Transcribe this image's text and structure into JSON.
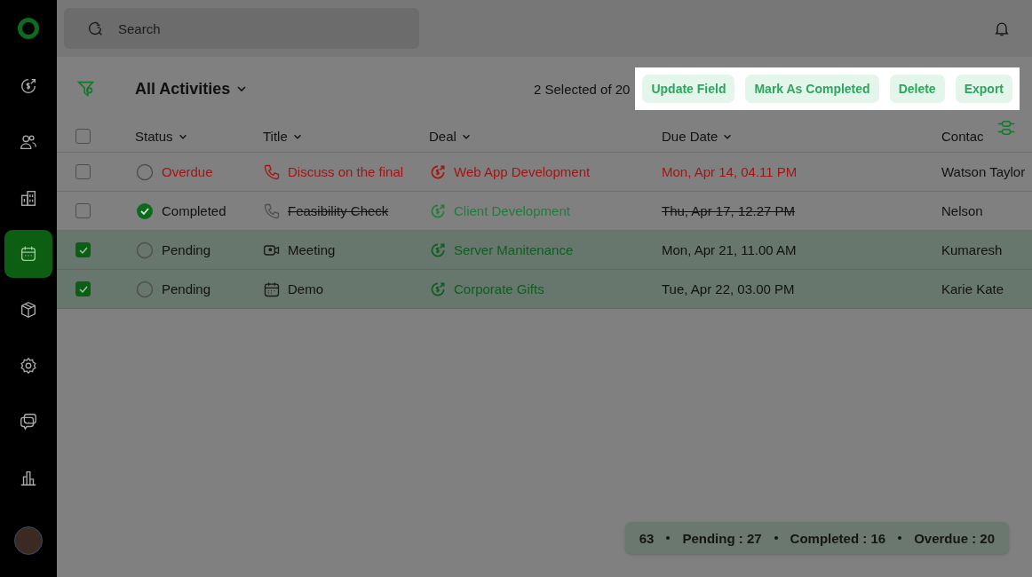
{
  "sidebar": {
    "items": [
      {
        "selected": false
      },
      {
        "selected": false
      },
      {
        "selected": false
      },
      {
        "selected": true
      },
      {
        "selected": false
      },
      {
        "selected": false
      },
      {
        "selected": false
      },
      {
        "selected": false
      }
    ]
  },
  "search": {
    "placeholder": "Search"
  },
  "view": {
    "title": "All Activities"
  },
  "selection": {
    "summary": "2 Selected of 20",
    "actions": [
      "Update Field",
      "Mark As Completed",
      "Delete",
      "Export"
    ]
  },
  "table": {
    "all_checked": false,
    "columns": [
      "Status",
      "Title",
      "Deal",
      "Due Date",
      "Contac"
    ],
    "rows": [
      {
        "checked": false,
        "kind": "overdue",
        "status": "Overdue",
        "title": {
          "kind": "call",
          "text": "Discuss on the final"
        },
        "deal": "Web App Development",
        "due": "Mon, Apr 14, 04.11 PM",
        "contact": "Watson Taylor"
      },
      {
        "checked": false,
        "kind": "completed",
        "status": "Completed",
        "title": {
          "kind": "call",
          "text": "Feasibility Check"
        },
        "deal": "Client Development",
        "due": "Thu, Apr 17, 12.27 PM",
        "contact": "Nelson"
      },
      {
        "checked": true,
        "kind": "pending",
        "status": "Pending",
        "title": {
          "kind": "video",
          "text": "Meeting"
        },
        "deal": "Server Manitenance",
        "due": "Mon, Apr 21, 11.00 AM",
        "contact": "Kumaresh"
      },
      {
        "checked": true,
        "kind": "pending",
        "status": "Pending",
        "title": {
          "kind": "calendar",
          "text": "Demo"
        },
        "deal": "Corporate Gifts",
        "due": "Tue, Apr 22, 03.00 PM",
        "contact": "Karie Kate"
      }
    ]
  },
  "summary": [
    "63",
    "Pending : 27",
    "Completed : 16",
    "Overdue : 20"
  ]
}
